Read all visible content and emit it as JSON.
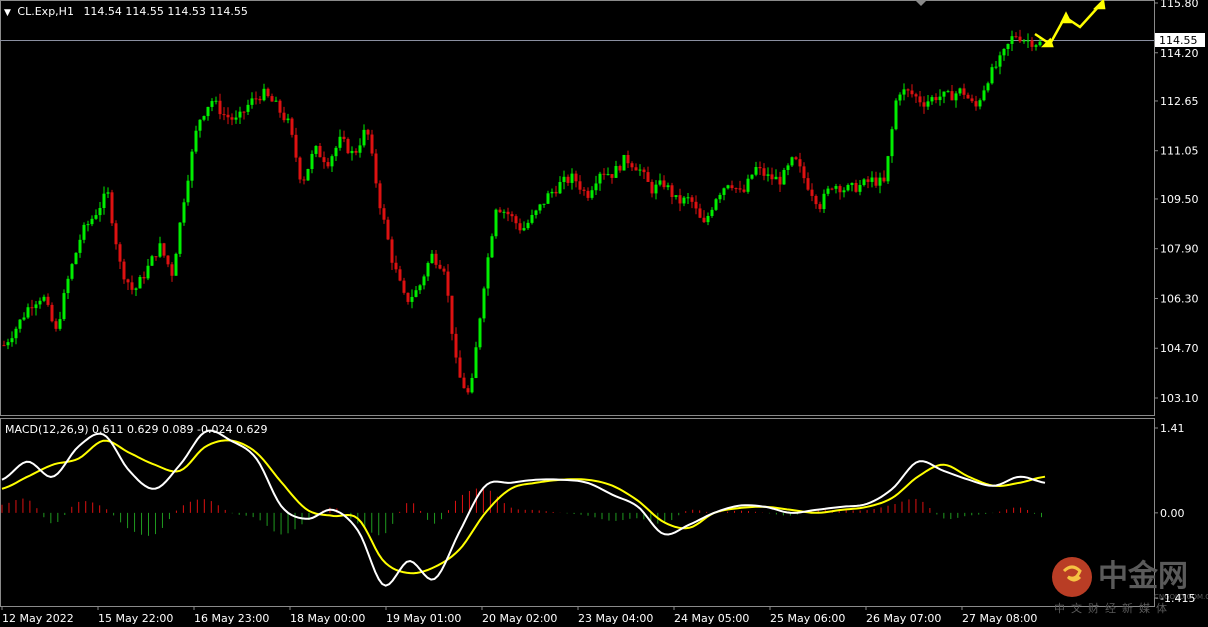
{
  "header": {
    "arrow": "▼",
    "symbol": "CL.Exp,H1",
    "ohlc": "114.54 114.55 114.53 114.55"
  },
  "macd_header": "MACD(12,26,9) 0.611 0.629 0.089 -0.024 0.629",
  "price_tag": "114.55",
  "price_axis_labels": [
    "115.80",
    "114.20",
    "112.65",
    "111.05",
    "109.50",
    "107.90",
    "106.30",
    "104.70",
    "103.10"
  ],
  "macd_axis_labels": [
    "1.41",
    "0.00",
    "-1.415"
  ],
  "time_axis_labels": [
    "12 May 2022",
    "15 May 22:00",
    "16 May 23:00",
    "18 May 00:00",
    "19 May 01:00",
    "20 May 02:00",
    "23 May 04:00",
    "24 May 05:00",
    "25 May 06:00",
    "26 May 07:00",
    "27 May 08:00"
  ],
  "watermark": {
    "main": "中金网",
    "sub": "中文财经新媒体",
    "url": "CNGOLD.COM.CN"
  },
  "colors": {
    "bull": "#00ee00",
    "bear": "#dd1111",
    "macd_line": "#ffffff",
    "signal_line": "#ffff00",
    "arrow": "#ffff00",
    "grid_border": "#8a8a8a"
  },
  "chart_data": [
    {
      "type": "candlestick",
      "title": "CL.Exp,H1",
      "ylim": [
        102.4,
        115.9
      ],
      "close_path": [
        104.8,
        105.4,
        106.1,
        106.4,
        105.2,
        107.0,
        108.4,
        109.0,
        109.7,
        107.3,
        106.5,
        107.2,
        108.0,
        107.1,
        109.8,
        112.0,
        112.7,
        112.2,
        112.0,
        112.6,
        112.9,
        112.5,
        111.9,
        110.0,
        111.1,
        110.7,
        111.4,
        110.9,
        111.8,
        109.4,
        107.5,
        106.2,
        106.6,
        107.7,
        107.3,
        103.9,
        103.1,
        106.6,
        109.3,
        109.0,
        108.5,
        109.0,
        109.6,
        110.0,
        110.2,
        109.6,
        110.4,
        110.3,
        110.8,
        110.5,
        109.8,
        110.0,
        109.4,
        109.5,
        108.6,
        109.6,
        110.1,
        109.6,
        110.5,
        110.2,
        110.1,
        110.8,
        110.0,
        109.3,
        110.0,
        109.8,
        109.9,
        110.1,
        110.0,
        113.0,
        112.9,
        112.6,
        112.8,
        112.8,
        113.0,
        112.4,
        113.4,
        114.0,
        114.8,
        114.6,
        114.5
      ]
    },
    {
      "type": "line",
      "title": "MACD(12,26,9)",
      "ylim": [
        -1.415,
        1.41
      ],
      "series": [
        {
          "name": "MACD",
          "values": [
            0.55,
            0.85,
            0.6,
            1.1,
            1.3,
            0.7,
            0.4,
            0.8,
            1.35,
            1.2,
            0.9,
            0.1,
            -0.1,
            0.05,
            -0.3,
            -1.2,
            -0.8,
            -1.1,
            -0.3,
            0.45,
            0.5,
            0.55,
            0.55,
            0.5,
            0.3,
            0.1,
            -0.35,
            -0.2,
            0.0,
            0.12,
            0.1,
            0.0,
            0.05,
            0.1,
            0.15,
            0.4,
            0.85,
            0.7,
            0.55,
            0.45,
            0.6,
            0.5
          ]
        },
        {
          "name": "Signal",
          "values": [
            0.4,
            0.6,
            0.8,
            0.9,
            1.2,
            1.0,
            0.8,
            0.7,
            1.1,
            1.2,
            1.0,
            0.5,
            0.05,
            -0.05,
            -0.1,
            -0.8,
            -1.0,
            -0.9,
            -0.6,
            0.0,
            0.4,
            0.5,
            0.55,
            0.55,
            0.45,
            0.2,
            -0.15,
            -0.25,
            0.0,
            0.08,
            0.1,
            0.05,
            0.0,
            0.05,
            0.1,
            0.25,
            0.6,
            0.8,
            0.6,
            0.45,
            0.5,
            0.6
          ]
        }
      ]
    }
  ]
}
